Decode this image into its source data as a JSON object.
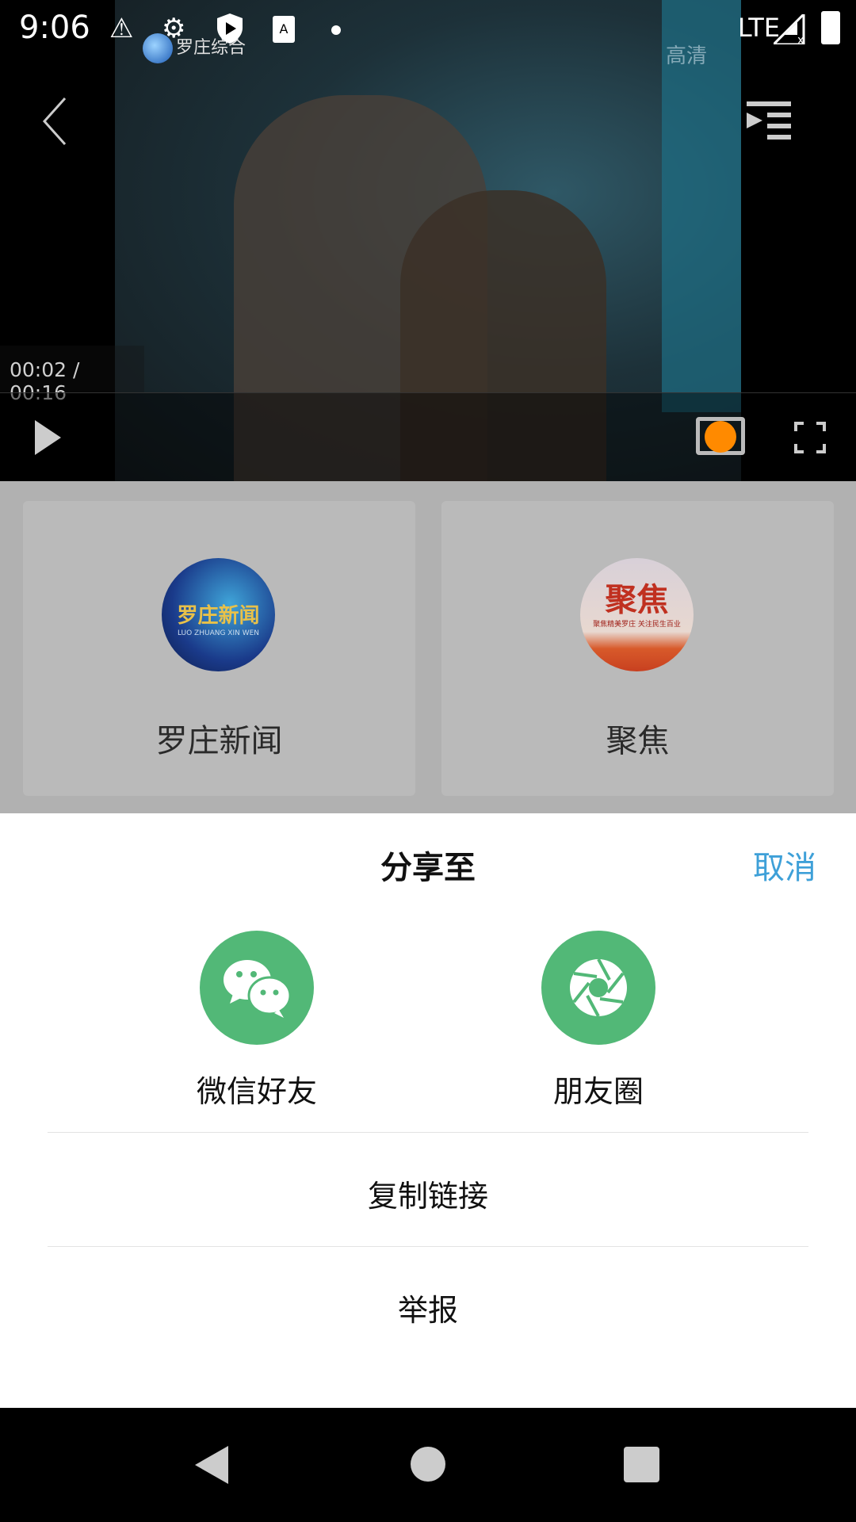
{
  "status_bar": {
    "time": "9:06",
    "network": "LTE",
    "icons": [
      "warning-icon",
      "settings-icon",
      "shield-play-icon",
      "font-icon",
      "dot-icon",
      "signal-icon",
      "battery-icon"
    ]
  },
  "video": {
    "channel_logo": "罗庄综合",
    "quality": "高清",
    "time_display": "00:02 / 00:16",
    "playing": false,
    "cast_color": "#ff8a00"
  },
  "programs": [
    {
      "label": "罗庄新闻",
      "logo_text": "罗庄新闻",
      "logo_subtext": "LUO ZHUANG XIN WEN"
    },
    {
      "label": "聚焦",
      "logo_text": "聚焦",
      "logo_subtext": "聚焦精美罗庄 关注民生百业"
    }
  ],
  "share_sheet": {
    "title": "分享至",
    "cancel": "取消",
    "targets": [
      {
        "label": "微信好友",
        "icon": "wechat-icon"
      },
      {
        "label": "朋友圈",
        "icon": "moments-icon"
      }
    ],
    "copy_link": "复制链接",
    "report": "举报",
    "accent": "#3ea0d8",
    "icon_bg": "#52b877"
  }
}
